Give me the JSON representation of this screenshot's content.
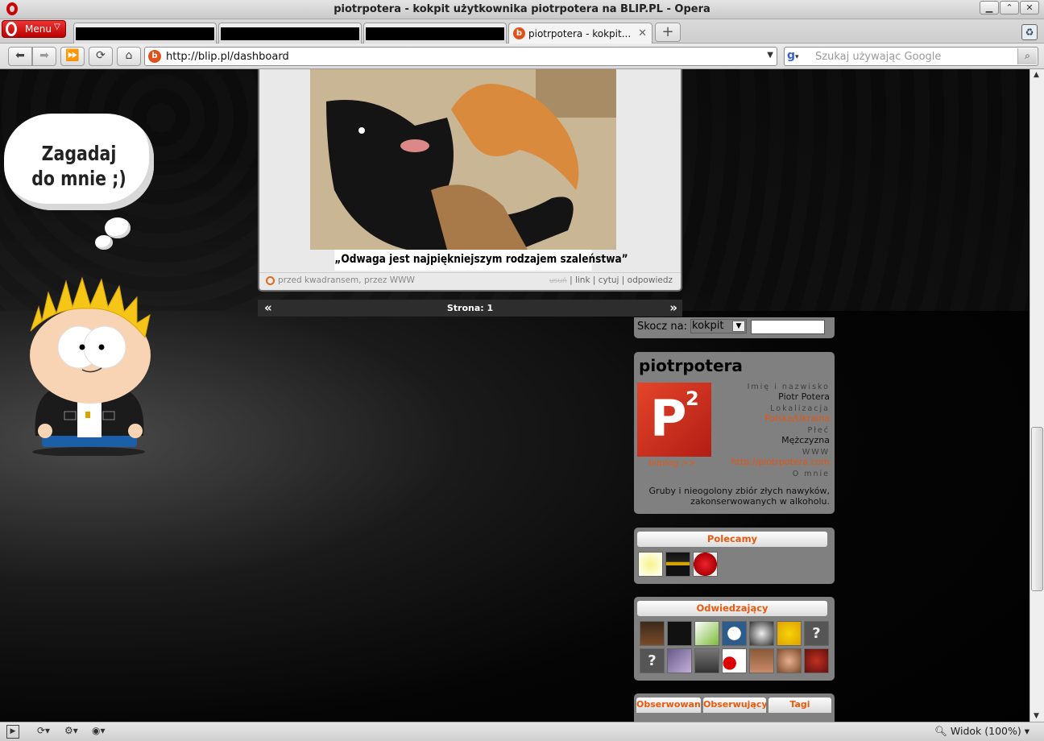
{
  "window": {
    "title": "piotrpotera - kokpit użytkownika piotrpotera na BLIP.PL - Opera",
    "buttons": [
      "minimize",
      "maximize",
      "close"
    ]
  },
  "tabbar": {
    "menu_label": "Menu",
    "active_tab_label": "piotrpotera - kokpit...",
    "active_tab_favicon": "b"
  },
  "navbar": {
    "url": "http://blip.pl/dashboard",
    "search_placeholder": "Szukaj używając Google",
    "search_engine_icon": "google-icon"
  },
  "page": {
    "speech_bubble": [
      "Zagadaj",
      "do mnie ;)"
    ],
    "post": {
      "caption": "„Odwaga jest najpiękniejszym rodzajem szaleństwa”",
      "meta_left": "przed kwadransem, przez WWW",
      "meta_strike": "usuń",
      "actions": [
        "link",
        "cytuj",
        "odpowiedz"
      ]
    },
    "pager": {
      "label": "Strona: 1",
      "prev": "«",
      "next": "»"
    },
    "jump": {
      "label": "Skocz na:",
      "selected": "kokpit"
    },
    "profile": {
      "username": "piotrpotera",
      "bliplog": "bliplog >>",
      "fields": [
        {
          "label": "Imię i nazwisko",
          "value": "Piotr Potera",
          "link": false
        },
        {
          "label": "Lokalizacja",
          "value": "Polska/Ukraina",
          "link": true
        },
        {
          "label": "Płeć",
          "value": "Mężczyzna",
          "link": false
        },
        {
          "label": "WWW",
          "value": "http://piotrpotera.com",
          "link": true
        },
        {
          "label": "O mnie",
          "value": "",
          "link": false
        }
      ],
      "about": "Gruby i nieogolony zbiór złych nawyków, zakonserwowanych w alkoholu."
    },
    "recommended": {
      "title": "Polecamy"
    },
    "visitors": {
      "title": "Odwiedzający"
    },
    "tabs": [
      "Obserwowani",
      "Obserwujący",
      "Tagi"
    ]
  },
  "statusbar": {
    "zoom_label": "Widok (100%)"
  },
  "colors": {
    "accent": "#e85a0e",
    "opera_red": "#cc0000",
    "sidebar_box": "#808080"
  }
}
